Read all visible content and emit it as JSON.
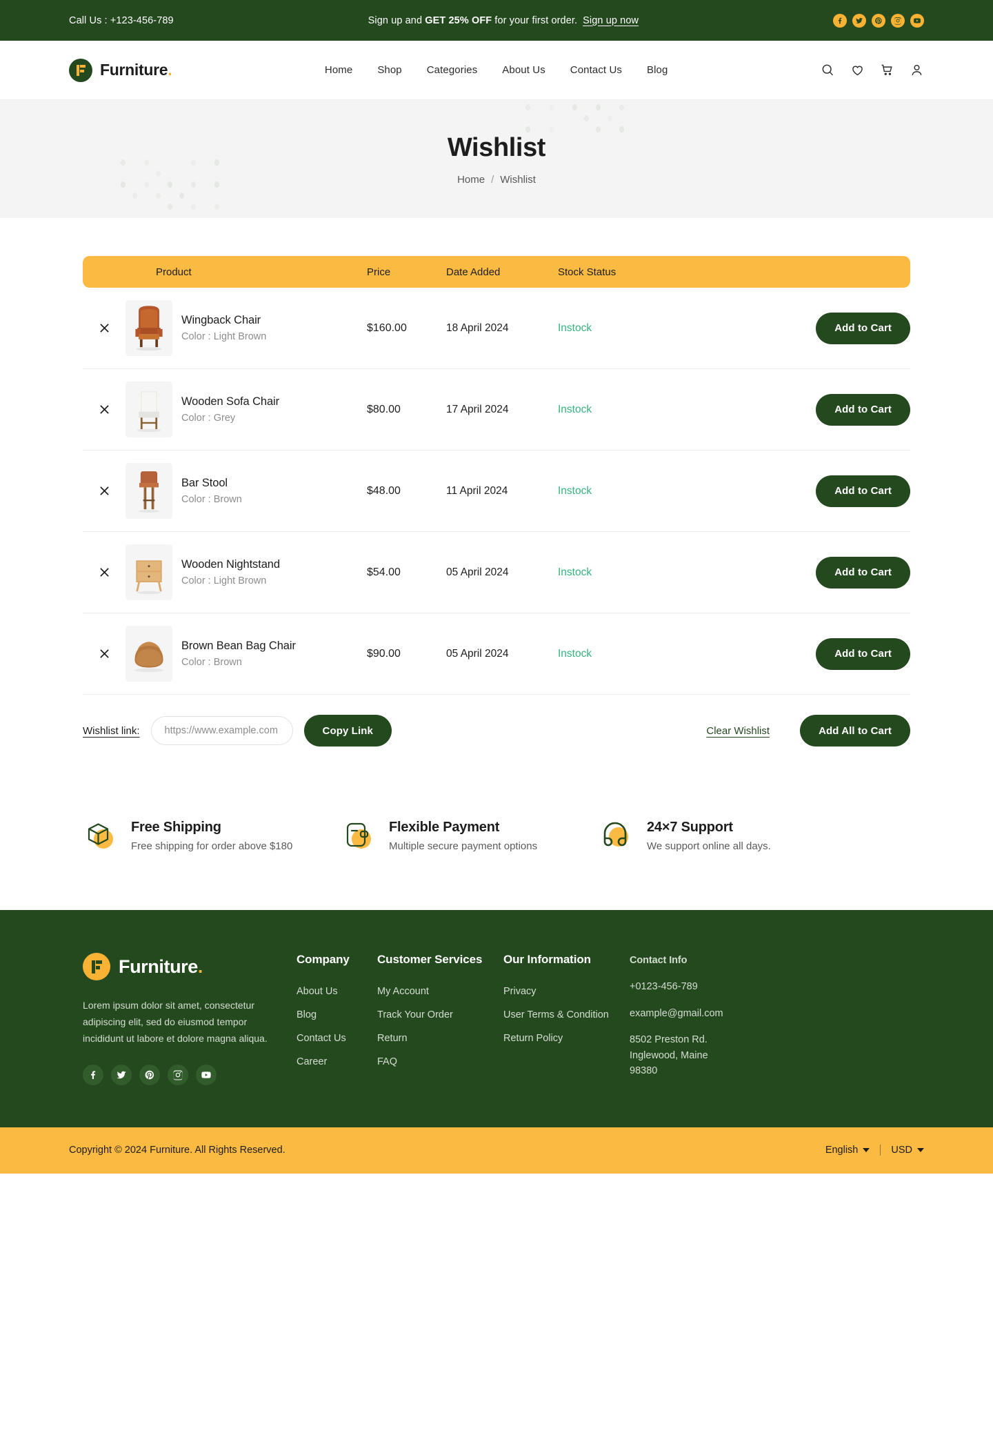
{
  "topbar": {
    "call_label": "Call Us :  +123-456-789",
    "promo_prefix": "Sign up and ",
    "promo_bold": "GET 25% OFF",
    "promo_suffix": " for your first order.",
    "promo_link": "Sign up now",
    "socials": [
      "facebook-icon",
      "twitter-icon",
      "pinterest-icon",
      "instagram-icon",
      "youtube-icon"
    ]
  },
  "header": {
    "brand_name": "Furniture",
    "brand_dot": ".",
    "nav": [
      {
        "label": "Home"
      },
      {
        "label": "Shop"
      },
      {
        "label": "Categories"
      },
      {
        "label": "About Us"
      },
      {
        "label": "Contact Us"
      },
      {
        "label": "Blog"
      }
    ],
    "icons": [
      "search-icon",
      "wishlist-heart-icon",
      "cart-icon",
      "account-icon"
    ]
  },
  "hero": {
    "title": "Wishlist",
    "breadcrumb_home": "Home",
    "breadcrumb_sep": "/",
    "breadcrumb_current": "Wishlist"
  },
  "table": {
    "headers": {
      "product": "Product",
      "price": "Price",
      "date": "Date Added",
      "stock": "Stock Status"
    },
    "add_to_cart_label": "Add to Cart",
    "rows": [
      {
        "name": "Wingback Chair",
        "color": "Color :  Light Brown",
        "price": "$160.00",
        "date": "18 April 2024",
        "stock": "Instock",
        "thumb": "wingback-chair-thumb"
      },
      {
        "name": "Wooden Sofa Chair",
        "color": "Color :   Grey",
        "price": "$80.00",
        "date": "17 April 2024",
        "stock": "Instock",
        "thumb": "wooden-sofa-chair-thumb"
      },
      {
        "name": "Bar Stool",
        "color": "Color :  Brown",
        "price": "$48.00",
        "date": "11 April 2024",
        "stock": "Instock",
        "thumb": "bar-stool-thumb"
      },
      {
        "name": "Wooden Nightstand",
        "color": "Color :  Light Brown",
        "price": "$54.00",
        "date": "05 April 2024",
        "stock": "Instock",
        "thumb": "wooden-nightstand-thumb"
      },
      {
        "name": "Brown Bean Bag Chair",
        "color": "Color : Brown",
        "price": "$90.00",
        "date": "05 April 2024",
        "stock": "Instock",
        "thumb": "bean-bag-chair-thumb"
      }
    ]
  },
  "actionbar": {
    "wishlist_link_label": "Wishlist link:",
    "link_placeholder": "https://www.example.com",
    "link_value": "",
    "copy_link_label": "Copy Link",
    "clear_wishlist_label": "Clear Wishlist",
    "add_all_label": "Add All to Cart"
  },
  "features": [
    {
      "icon": "shipping-box-icon",
      "title": "Free Shipping",
      "subtitle": "Free shipping for order above $180"
    },
    {
      "icon": "wallet-icon",
      "title": "Flexible Payment",
      "subtitle": "Multiple secure payment options"
    },
    {
      "icon": "headphones-icon",
      "title": "24×7 Support",
      "subtitle": "We support online all days."
    }
  ],
  "footer": {
    "brand_name": "Furniture",
    "brand_dot": ".",
    "description": "Lorem ipsum dolor sit amet, consectetur adipiscing elit, sed do eiusmod tempor incididunt ut labore et dolore magna aliqua.",
    "socials": [
      "facebook-icon",
      "twitter-icon",
      "pinterest-icon",
      "instagram-icon",
      "youtube-icon"
    ],
    "columns": [
      {
        "heading": "Company",
        "links": [
          "About Us",
          "Blog",
          "Contact Us",
          "Career"
        ]
      },
      {
        "heading": "Customer Services",
        "links": [
          "My Account",
          "Track Your Order",
          "Return",
          "FAQ"
        ]
      },
      {
        "heading": "Our Information",
        "links": [
          "Privacy",
          "User Terms & Condition",
          "Return Policy"
        ]
      }
    ],
    "contact": {
      "heading": "Contact Info",
      "phone": "+0123-456-789",
      "email": "example@gmail.com",
      "address": "8502 Preston Rd. Inglewood, Maine 98380"
    }
  },
  "copyright": {
    "text": "Copyright © 2024 Furniture. All Rights Reserved.",
    "language": "English",
    "currency": "USD"
  },
  "colors": {
    "brand_green": "#24491F",
    "brand_yellow": "#FBBA42",
    "instock_green": "#35B37E",
    "hero_bg": "#F4F4F4"
  }
}
